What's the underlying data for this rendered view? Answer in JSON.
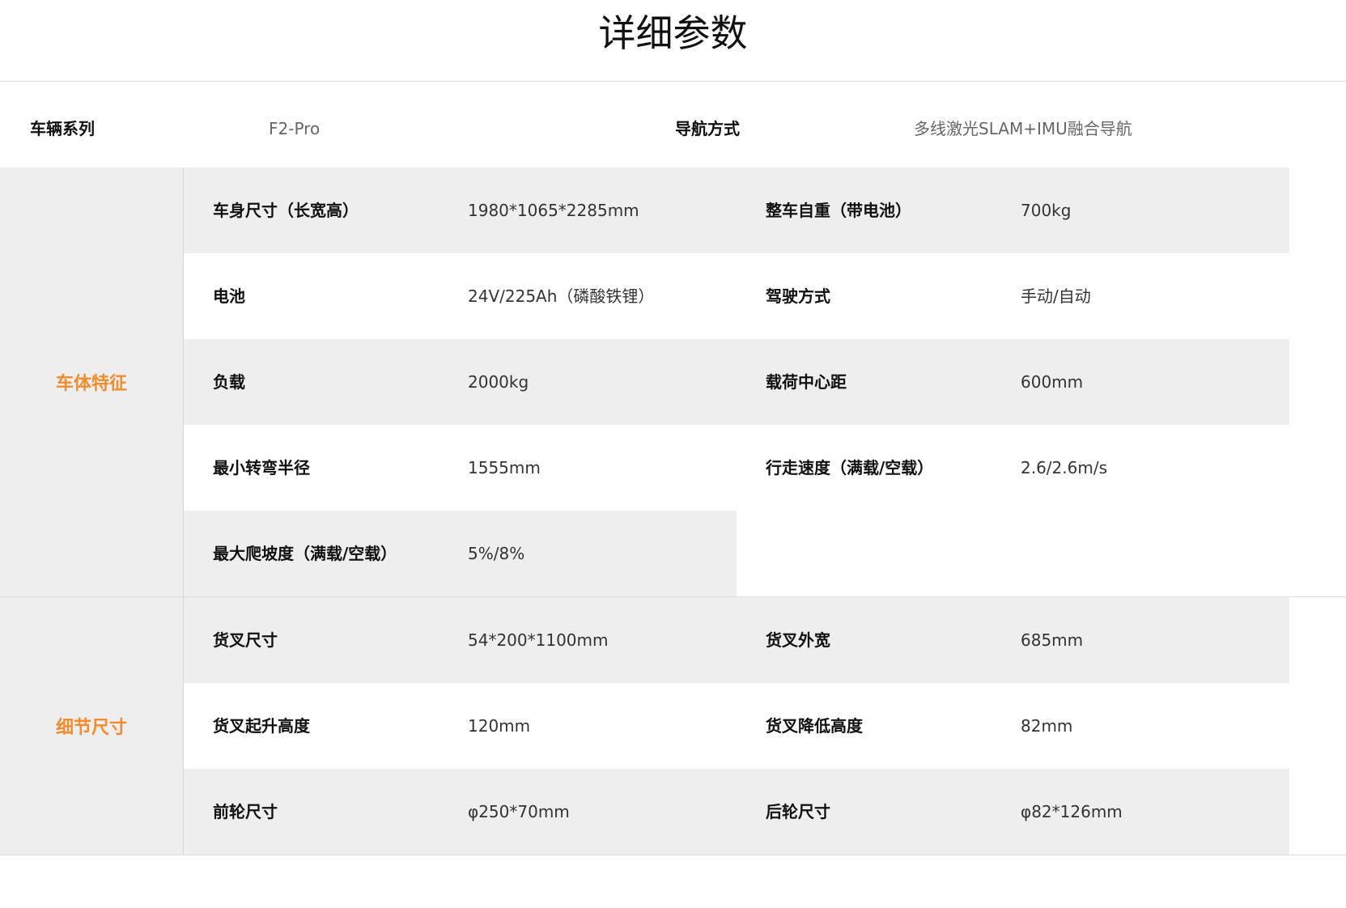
{
  "title": "详细参数",
  "series": {
    "label": "车辆系列",
    "value": "F2-Pro",
    "nav_label": "导航方式",
    "nav_value": "多线激光SLAM+IMU融合导航"
  },
  "sections": [
    {
      "label": "车体特征",
      "rows": [
        {
          "k1": "车身尺寸（长宽高）",
          "v1": "1980*1065*2285mm",
          "k2": "整车自重（带电池）",
          "v2": "700kg"
        },
        {
          "k1": "电池",
          "v1": "24V/225Ah（磷酸铁锂）",
          "k2": "驾驶方式",
          "v2": "手动/自动"
        },
        {
          "k1": "负载",
          "v1": "2000kg",
          "k2": "载荷中心距",
          "v2": "600mm"
        },
        {
          "k1": "最小转弯半径",
          "v1": "1555mm",
          "k2": "行走速度（满载/空载）",
          "v2": "2.6/2.6m/s"
        },
        {
          "k1": "最大爬坡度（满载/空载）",
          "v1": "5%/8%"
        }
      ]
    },
    {
      "label": "细节尺寸",
      "rows": [
        {
          "k1": "货叉尺寸",
          "v1": "54*200*1100mm",
          "k2": "货叉外宽",
          "v2": "685mm"
        },
        {
          "k1": "货叉起升高度",
          "v1": "120mm",
          "k2": "货叉降低高度",
          "v2": "82mm"
        },
        {
          "k1": "前轮尺寸",
          "v1": "φ250*70mm",
          "k2": "后轮尺寸",
          "v2": "φ82*126mm"
        }
      ]
    }
  ],
  "colors": {
    "accent": "#f08c2d",
    "row_gray": "#eeeeee",
    "divider": "#dcdcdc"
  }
}
